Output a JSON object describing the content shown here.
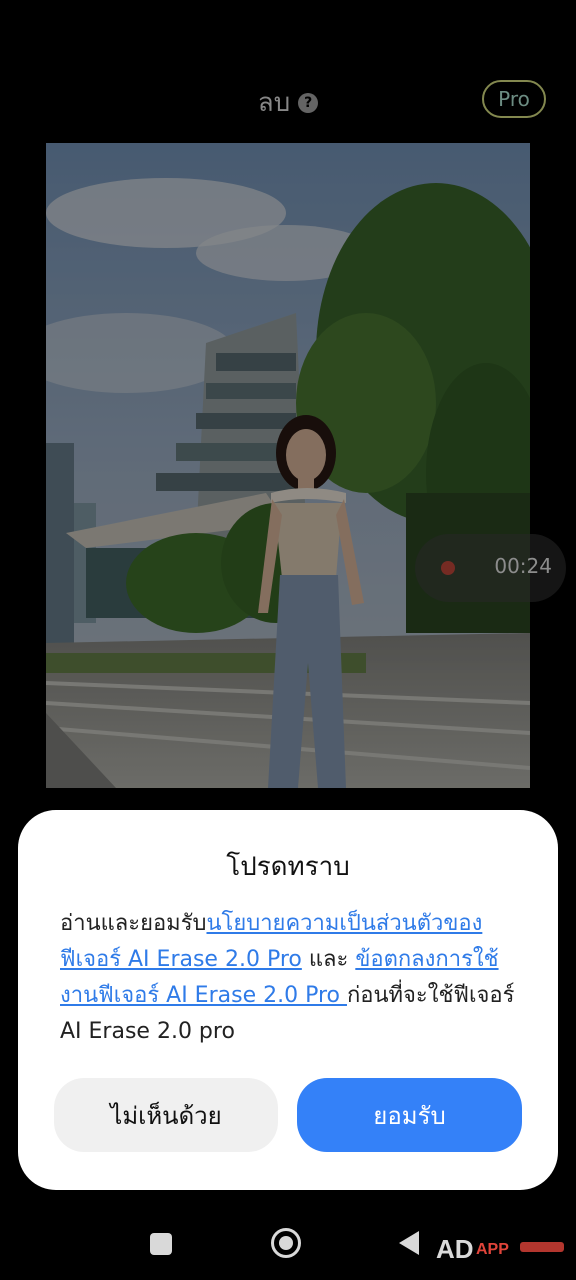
{
  "header": {
    "title": "ลบ",
    "help_icon": "help-circle-icon",
    "pro_badge": "Pro"
  },
  "recording": {
    "time": "00:24",
    "dot_color": "#e0443a"
  },
  "dialog": {
    "title": "โปรดทราบ",
    "body_prefix": "อ่านและยอมรับ",
    "privacy_link": "นโยบายความเป็นส่วนตัวของฟีเจอร์ AI Erase 2.0 Pro",
    "conjunction": " และ ",
    "terms_link": "ข้อตกลงการใช้งานฟีเจอร์ AI Erase 2.0 Pro ",
    "body_suffix": "ก่อนที่จะใช้ฟีเจอร์ AI Erase 2.0 pro",
    "decline_label": "ไม่เห็นด้วย",
    "accept_label": "ยอมรับ"
  },
  "colors": {
    "accent": "#3481f8",
    "link": "#2f7be8",
    "pro_border": "#c9d27a"
  },
  "navbar": {
    "recents_icon": "square-icon",
    "home_icon": "circle-home-icon",
    "back_icon": "triangle-back-icon"
  },
  "watermark": {
    "text_ad": "AD",
    "text_app": "APP"
  }
}
